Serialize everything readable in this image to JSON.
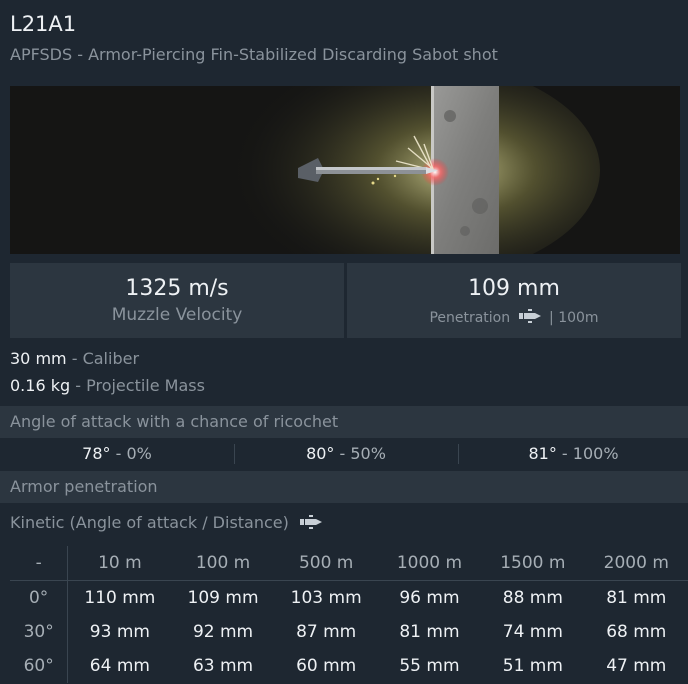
{
  "shell": {
    "name": "L21A1",
    "type_desc": "APFSDS - Armor-Piercing Fin-Stabilized Discarding Sabot shot"
  },
  "stats": {
    "muzzle_velocity": {
      "value": "1325 m/s",
      "label": "Muzzle Velocity"
    },
    "penetration": {
      "value": "109 mm",
      "label": "Penetration",
      "distance": "| 100m"
    }
  },
  "info": [
    {
      "value": "30 mm",
      "label": "- Caliber"
    },
    {
      "value": "0.16 kg",
      "label": "- Projectile Mass"
    }
  ],
  "ricochet": {
    "header": "Angle of attack with a chance of ricochet",
    "cells": [
      {
        "angle": "78°",
        "chance": "- 0%"
      },
      {
        "angle": "80°",
        "chance": "- 50%"
      },
      {
        "angle": "81°",
        "chance": "- 100%"
      }
    ]
  },
  "armor": {
    "header": "Armor penetration",
    "kinetic_label": "Kinetic (Angle of attack / Distance)",
    "corner": "-",
    "distances": [
      "10 m",
      "100 m",
      "500 m",
      "1000 m",
      "1500 m",
      "2000 m"
    ],
    "rows": [
      {
        "angle": "0°",
        "values": [
          "110 mm",
          "109 mm",
          "103 mm",
          "96 mm",
          "88 mm",
          "81 mm"
        ]
      },
      {
        "angle": "30°",
        "values": [
          "93 mm",
          "92 mm",
          "87 mm",
          "81 mm",
          "74 mm",
          "68 mm"
        ]
      },
      {
        "angle": "60°",
        "values": [
          "64 mm",
          "63 mm",
          "60 mm",
          "55 mm",
          "51 mm",
          "47 mm"
        ]
      }
    ]
  },
  "icons": {
    "shell_icon": "shell-icon"
  },
  "colors": {
    "background": "#1e2731",
    "panel": "#2c3640",
    "text_primary": "#eef1f4",
    "text_secondary": "#8a939c"
  }
}
